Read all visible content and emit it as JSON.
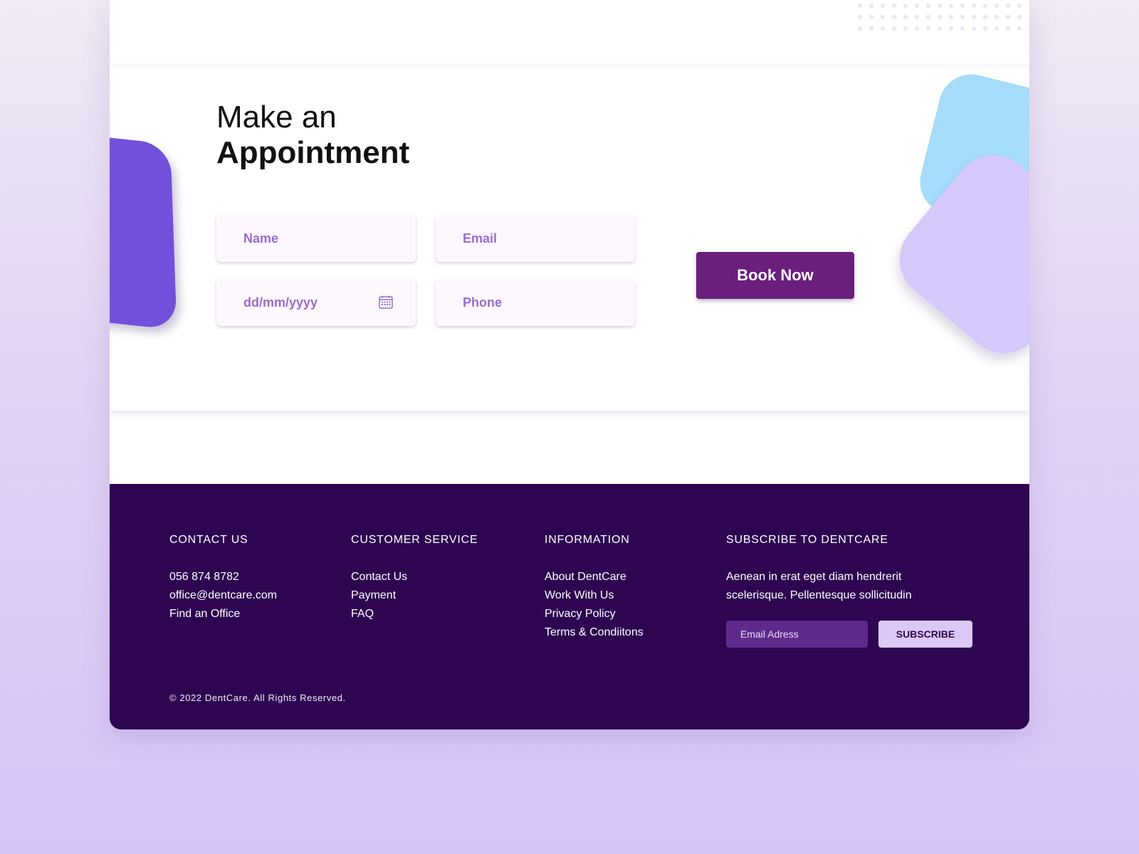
{
  "appointment": {
    "title_line1": "Make an",
    "title_line2": "Appointment",
    "fields": {
      "name_placeholder": "Name",
      "email_placeholder": "Email",
      "date_placeholder": "dd/mm/yyyy",
      "phone_placeholder": "Phone"
    },
    "book_label": "Book Now"
  },
  "footer": {
    "contact": {
      "heading": "CONTACT US",
      "items": [
        "056 874 8782",
        "office@dentcare.com",
        "Find an Office"
      ]
    },
    "customer_service": {
      "heading": "CUSTOMER SERVICE",
      "items": [
        "Contact Us",
        "Payment",
        "FAQ"
      ]
    },
    "information": {
      "heading": "INFORMATION",
      "items": [
        "About DentCare",
        "Work With Us",
        "Privacy Policy",
        "Terms & Condiitons"
      ]
    },
    "subscribe": {
      "heading": "SUBSCRIBE TO DENTCARE",
      "text": "Aenean in erat eget diam hendrerit scelerisque. Pellentesque sollicitudin",
      "email_placeholder": "Email Adress",
      "button_label": "SUBSCRIBE"
    },
    "copyright": "©  2022 DentCare. All Rights Reserved."
  },
  "colors": {
    "footer_bg": "#2d0551",
    "book_button": "#6a1f7d",
    "accent_purple": "#7350db",
    "blob_blue": "#a4dcfa",
    "blob_lilac": "#d5c8fa",
    "placeholder": "#9b6cc9"
  },
  "icons": {
    "date_field": "calendar-icon"
  }
}
